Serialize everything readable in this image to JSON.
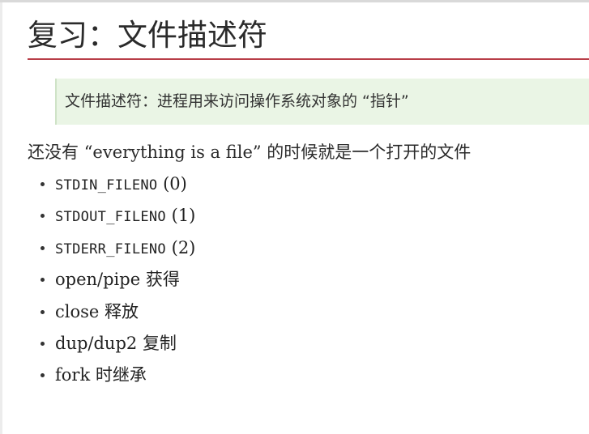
{
  "slide": {
    "title": "复习：文件描述符",
    "callout": "文件描述符：进程用来访问操作系统对象的 “指针”",
    "intro": {
      "prefix": "还没有 ",
      "quote": "“everything is a file”",
      "suffix": " 的时候就是一个打开的文件"
    },
    "bullets": [
      {
        "code": "STDIN_FILENO",
        "text": " (0)",
        "cjk": ""
      },
      {
        "code": "STDOUT_FILENO",
        "text": " (1)",
        "cjk": ""
      },
      {
        "code": "STDERR_FILENO",
        "text": " (2)",
        "cjk": ""
      },
      {
        "code": "",
        "text": "open/pipe ",
        "cjk": "获得"
      },
      {
        "code": "",
        "text": "close ",
        "cjk": "释放"
      },
      {
        "code": "",
        "text": "dup/dup2 ",
        "cjk": "复制"
      },
      {
        "code": "",
        "text": "fork ",
        "cjk": "时继承"
      }
    ]
  },
  "colors": {
    "title_underline": "#b83e48",
    "callout_background": "#eaf5e5"
  }
}
